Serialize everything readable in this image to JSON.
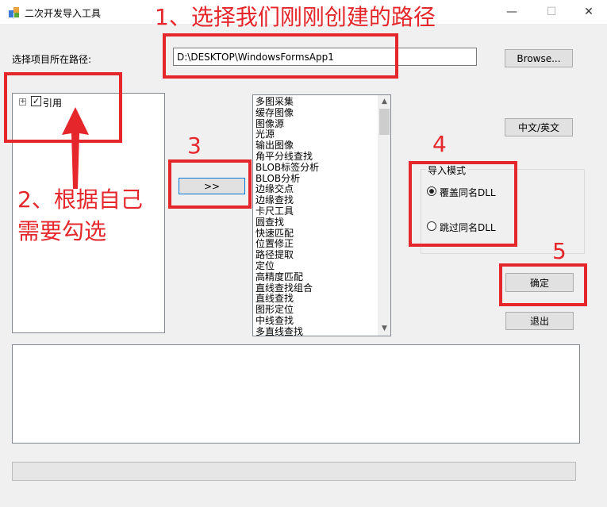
{
  "window": {
    "title": "二次开发导入工具",
    "minimize_glyph": "—",
    "maximize_glyph": "☐",
    "close_glyph": "✕"
  },
  "path_section": {
    "label": "选择项目所在路径:",
    "value": "D:\\DESKTOP\\WindowsFormsApp1",
    "browse_label": "Browse..."
  },
  "tree": {
    "expander_glyph": "+",
    "check_glyph": "✓",
    "item_label": "引用",
    "checked": true
  },
  "transfer_button_label": ">>",
  "list": {
    "items": [
      "多图采集",
      "缓存图像",
      "图像源",
      "光源",
      "输出图像",
      "角平分线查找",
      "BLOB标签分析",
      "BLOB分析",
      "边缘交点",
      "边缘查找",
      "卡尺工具",
      "圆查找",
      "快速匹配",
      "位置修正",
      "路径提取",
      "定位",
      "高精度匹配",
      "直线查找组合",
      "直线查找",
      "图形定位",
      "中线查找",
      "多直线查找"
    ],
    "scroll_up_glyph": "▲",
    "scroll_down_glyph": "▼"
  },
  "lang_button_label": "中文/英文",
  "import_mode": {
    "title": "导入模式",
    "options": [
      {
        "label": "覆盖同名DLL",
        "selected": true
      },
      {
        "label": "跳过同名DLL",
        "selected": false
      }
    ]
  },
  "ok_label": "确定",
  "exit_label": "退出",
  "progress": {
    "value_percent": 0
  },
  "annotations": {
    "step1": "1、选择我们刚刚创建的路径",
    "step2_line1": "2、根据自己",
    "step2_line2": "需要勾选",
    "step3": "3",
    "step4": "4",
    "step5": "5"
  },
  "colors": {
    "annotation_red": "#e5262b",
    "button_face": "#e1e1e1",
    "focus_blue": "#0078d7"
  }
}
